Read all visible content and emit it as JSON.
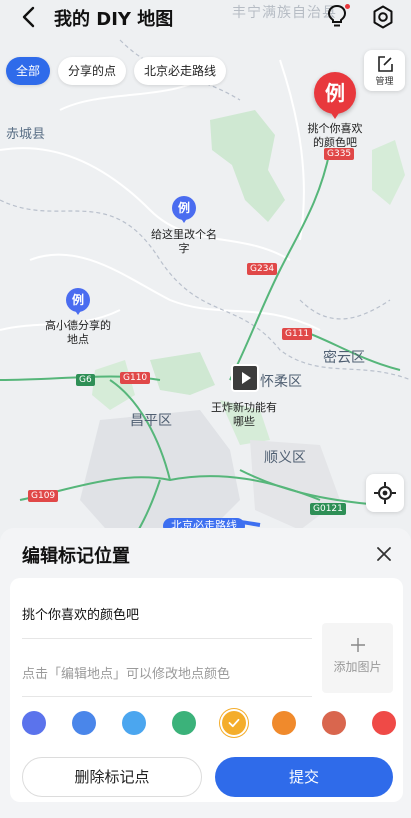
{
  "header": {
    "title": "我的 DIY 地图",
    "faint_place": "丰宁满族自治县"
  },
  "filters": [
    "全部",
    "分享的点",
    "北京必走路线"
  ],
  "manage_label": "管理",
  "map": {
    "places": {
      "chicheng": "赤城县",
      "miyun": "密云区",
      "huairou": "怀柔区",
      "changping": "昌平区",
      "shunyi": "顺义区",
      "route_label": "北京必走路线"
    },
    "roads": [
      "G335",
      "G234",
      "G111",
      "G6",
      "G110",
      "G109",
      "G0121"
    ],
    "pins": {
      "marker_char": "例",
      "red_label": "挑个你喜欢的颜色吧",
      "blue1_label": "给这里改个名字",
      "blue2_label": "高小德分享的地点",
      "video_label": "王炸新功能有哪些"
    }
  },
  "sheet": {
    "title": "编辑标记位置",
    "name_value": "挑个你喜欢的颜色吧",
    "hint": "点击「编辑地点」可以修改地点颜色",
    "add_photo": "添加图片",
    "colors": [
      "#5b73ec",
      "#4a86ea",
      "#4ba6ef",
      "#3bb27a",
      "#f4ad2b",
      "#f08a2c",
      "#d9664e",
      "#ef4a47"
    ],
    "selected_color_index": 4,
    "delete_label": "删除标记点",
    "submit_label": "提交"
  }
}
